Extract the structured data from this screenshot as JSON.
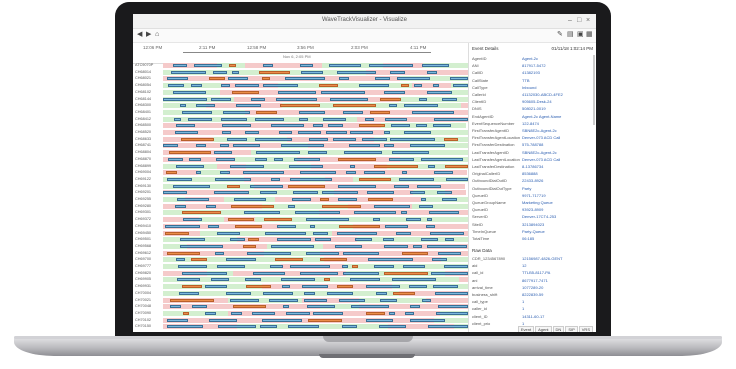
{
  "window": {
    "title": "WaveTrackVisualizer - Visualize"
  },
  "toolbar": {
    "back_icon": "arrow-left-icon",
    "forward_icon": "arrow-right-icon",
    "home_icon": "home-icon"
  },
  "axis": {
    "ticks": [
      "12:06 PM",
      "2:11 PM",
      "12:58 PM",
      "3:56 PM",
      "2:03 PM",
      "4:11 PM"
    ],
    "range": "Nov 6, 2:05 PM"
  },
  "rows": [
    "ATC9070P",
    "CH68014",
    "CH68021",
    "CH68054",
    "CH68102",
    "CH68144",
    "CH68300",
    "CH68401",
    "CH68412",
    "CH68500",
    "CH68520",
    "CH68633",
    "CH68741",
    "CH68804",
    "CH68870",
    "CH68899",
    "CH69004",
    "CH69122",
    "CH69130",
    "CH69201",
    "CH69255",
    "CH69280",
    "CH69301",
    "CH69372",
    "CH69410",
    "CH69450",
    "CH69501",
    "CH69568",
    "CH69612",
    "CH69700",
    "CH69777",
    "CH69820",
    "CH69905",
    "CH69931",
    "CH70004",
    "CH70021",
    "CH70048",
    "CH70090",
    "CH70102",
    "CH70150"
  ],
  "detail": {
    "header": "Event Details",
    "time": "01/11/18 1:02:14 PM",
    "fields": [
      {
        "k": "AgentID",
        "v": "Agent-2c"
      },
      {
        "k": "ANI",
        "v": "817917-5472"
      },
      {
        "k": "CallID",
        "v": "41382193"
      },
      {
        "k": "CallState",
        "v": "TTB"
      },
      {
        "k": "CallType",
        "v": "Inbound"
      },
      {
        "k": "CallerId",
        "v": "41132030-ABCD-4FE2"
      },
      {
        "k": "ClientID",
        "v": "905605-Desk-24"
      },
      {
        "k": "DNIS",
        "v": "508021-0019"
      },
      {
        "k": "EndAgentID",
        "v": "Agent-2c Agent-Name"
      },
      {
        "k": "EventSequenceNumber",
        "v": "122-8474"
      },
      {
        "k": "FirstTransferAgentID",
        "v": "SBN8E2c-Agent-2c"
      },
      {
        "k": "FirstTransferAgentLocation",
        "v": "Denver-073 ACD Call"
      },
      {
        "k": "FirstTransferDestination",
        "v": "575-788788"
      },
      {
        "k": "LastTransferAgentID",
        "v": "SBN8E2c-Agent-2c"
      },
      {
        "k": "LastTransferAgentLocation",
        "v": "Denver-073 ACD Call"
      },
      {
        "k": "LastTransferDestination",
        "v": "8-13786734"
      },
      {
        "k": "OriginalCallerID",
        "v": "8536888"
      },
      {
        "k": "OutboundDialOutID",
        "v": "22433-8926"
      },
      {
        "k": "OutboundDialOutType",
        "v": "Party"
      },
      {
        "k": "QueueID",
        "v": "9971-717719"
      },
      {
        "k": "QueueGroupName",
        "v": "Marketing Queue"
      },
      {
        "k": "QueueID",
        "v": "93923-8909"
      },
      {
        "k": "ServerID",
        "v": "Denver-17CT4-253"
      },
      {
        "k": "SiteID",
        "v": "3213894023"
      },
      {
        "k": "TimeInQueue",
        "v": "Party-Queue"
      },
      {
        "k": "TotalTime",
        "v": "06:185"
      }
    ],
    "section2": "Raw Data",
    "fields2": [
      {
        "k": "CDR_1234567890",
        "v": "12156987-4826-GENT"
      },
      {
        "k": "aid",
        "v": "12"
      },
      {
        "k": "call_id",
        "v": "TTLB5-8117-PA"
      },
      {
        "k": "ani",
        "v": "8677917-7471"
      },
      {
        "k": "arrival_time",
        "v": "1077289-20"
      },
      {
        "k": "business_shift",
        "v": "8222839-59"
      },
      {
        "k": "call_type",
        "v": "1"
      },
      {
        "k": "caller_id",
        "v": "1"
      },
      {
        "k": "client_ID",
        "v": "14311-60-17"
      },
      {
        "k": "client_prio",
        "v": "1"
      }
    ],
    "tabs": [
      "Event",
      "Agent",
      "DN",
      "SIP",
      "VRS"
    ]
  }
}
